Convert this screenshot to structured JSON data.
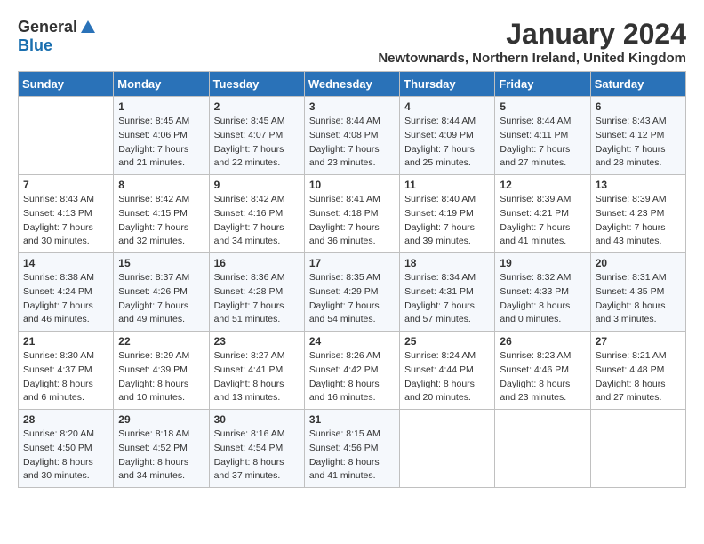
{
  "logo": {
    "general": "General",
    "blue": "Blue"
  },
  "title": {
    "month_year": "January 2024",
    "location": "Newtownards, Northern Ireland, United Kingdom"
  },
  "days_of_week": [
    "Sunday",
    "Monday",
    "Tuesday",
    "Wednesday",
    "Thursday",
    "Friday",
    "Saturday"
  ],
  "weeks": [
    [
      {
        "day": "",
        "sunrise": "",
        "sunset": "",
        "daylight": ""
      },
      {
        "day": "1",
        "sunrise": "Sunrise: 8:45 AM",
        "sunset": "Sunset: 4:06 PM",
        "daylight": "Daylight: 7 hours and 21 minutes."
      },
      {
        "day": "2",
        "sunrise": "Sunrise: 8:45 AM",
        "sunset": "Sunset: 4:07 PM",
        "daylight": "Daylight: 7 hours and 22 minutes."
      },
      {
        "day": "3",
        "sunrise": "Sunrise: 8:44 AM",
        "sunset": "Sunset: 4:08 PM",
        "daylight": "Daylight: 7 hours and 23 minutes."
      },
      {
        "day": "4",
        "sunrise": "Sunrise: 8:44 AM",
        "sunset": "Sunset: 4:09 PM",
        "daylight": "Daylight: 7 hours and 25 minutes."
      },
      {
        "day": "5",
        "sunrise": "Sunrise: 8:44 AM",
        "sunset": "Sunset: 4:11 PM",
        "daylight": "Daylight: 7 hours and 27 minutes."
      },
      {
        "day": "6",
        "sunrise": "Sunrise: 8:43 AM",
        "sunset": "Sunset: 4:12 PM",
        "daylight": "Daylight: 7 hours and 28 minutes."
      }
    ],
    [
      {
        "day": "7",
        "sunrise": "Sunrise: 8:43 AM",
        "sunset": "Sunset: 4:13 PM",
        "daylight": "Daylight: 7 hours and 30 minutes."
      },
      {
        "day": "8",
        "sunrise": "Sunrise: 8:42 AM",
        "sunset": "Sunset: 4:15 PM",
        "daylight": "Daylight: 7 hours and 32 minutes."
      },
      {
        "day": "9",
        "sunrise": "Sunrise: 8:42 AM",
        "sunset": "Sunset: 4:16 PM",
        "daylight": "Daylight: 7 hours and 34 minutes."
      },
      {
        "day": "10",
        "sunrise": "Sunrise: 8:41 AM",
        "sunset": "Sunset: 4:18 PM",
        "daylight": "Daylight: 7 hours and 36 minutes."
      },
      {
        "day": "11",
        "sunrise": "Sunrise: 8:40 AM",
        "sunset": "Sunset: 4:19 PM",
        "daylight": "Daylight: 7 hours and 39 minutes."
      },
      {
        "day": "12",
        "sunrise": "Sunrise: 8:39 AM",
        "sunset": "Sunset: 4:21 PM",
        "daylight": "Daylight: 7 hours and 41 minutes."
      },
      {
        "day": "13",
        "sunrise": "Sunrise: 8:39 AM",
        "sunset": "Sunset: 4:23 PM",
        "daylight": "Daylight: 7 hours and 43 minutes."
      }
    ],
    [
      {
        "day": "14",
        "sunrise": "Sunrise: 8:38 AM",
        "sunset": "Sunset: 4:24 PM",
        "daylight": "Daylight: 7 hours and 46 minutes."
      },
      {
        "day": "15",
        "sunrise": "Sunrise: 8:37 AM",
        "sunset": "Sunset: 4:26 PM",
        "daylight": "Daylight: 7 hours and 49 minutes."
      },
      {
        "day": "16",
        "sunrise": "Sunrise: 8:36 AM",
        "sunset": "Sunset: 4:28 PM",
        "daylight": "Daylight: 7 hours and 51 minutes."
      },
      {
        "day": "17",
        "sunrise": "Sunrise: 8:35 AM",
        "sunset": "Sunset: 4:29 PM",
        "daylight": "Daylight: 7 hours and 54 minutes."
      },
      {
        "day": "18",
        "sunrise": "Sunrise: 8:34 AM",
        "sunset": "Sunset: 4:31 PM",
        "daylight": "Daylight: 7 hours and 57 minutes."
      },
      {
        "day": "19",
        "sunrise": "Sunrise: 8:32 AM",
        "sunset": "Sunset: 4:33 PM",
        "daylight": "Daylight: 8 hours and 0 minutes."
      },
      {
        "day": "20",
        "sunrise": "Sunrise: 8:31 AM",
        "sunset": "Sunset: 4:35 PM",
        "daylight": "Daylight: 8 hours and 3 minutes."
      }
    ],
    [
      {
        "day": "21",
        "sunrise": "Sunrise: 8:30 AM",
        "sunset": "Sunset: 4:37 PM",
        "daylight": "Daylight: 8 hours and 6 minutes."
      },
      {
        "day": "22",
        "sunrise": "Sunrise: 8:29 AM",
        "sunset": "Sunset: 4:39 PM",
        "daylight": "Daylight: 8 hours and 10 minutes."
      },
      {
        "day": "23",
        "sunrise": "Sunrise: 8:27 AM",
        "sunset": "Sunset: 4:41 PM",
        "daylight": "Daylight: 8 hours and 13 minutes."
      },
      {
        "day": "24",
        "sunrise": "Sunrise: 8:26 AM",
        "sunset": "Sunset: 4:42 PM",
        "daylight": "Daylight: 8 hours and 16 minutes."
      },
      {
        "day": "25",
        "sunrise": "Sunrise: 8:24 AM",
        "sunset": "Sunset: 4:44 PM",
        "daylight": "Daylight: 8 hours and 20 minutes."
      },
      {
        "day": "26",
        "sunrise": "Sunrise: 8:23 AM",
        "sunset": "Sunset: 4:46 PM",
        "daylight": "Daylight: 8 hours and 23 minutes."
      },
      {
        "day": "27",
        "sunrise": "Sunrise: 8:21 AM",
        "sunset": "Sunset: 4:48 PM",
        "daylight": "Daylight: 8 hours and 27 minutes."
      }
    ],
    [
      {
        "day": "28",
        "sunrise": "Sunrise: 8:20 AM",
        "sunset": "Sunset: 4:50 PM",
        "daylight": "Daylight: 8 hours and 30 minutes."
      },
      {
        "day": "29",
        "sunrise": "Sunrise: 8:18 AM",
        "sunset": "Sunset: 4:52 PM",
        "daylight": "Daylight: 8 hours and 34 minutes."
      },
      {
        "day": "30",
        "sunrise": "Sunrise: 8:16 AM",
        "sunset": "Sunset: 4:54 PM",
        "daylight": "Daylight: 8 hours and 37 minutes."
      },
      {
        "day": "31",
        "sunrise": "Sunrise: 8:15 AM",
        "sunset": "Sunset: 4:56 PM",
        "daylight": "Daylight: 8 hours and 41 minutes."
      },
      {
        "day": "",
        "sunrise": "",
        "sunset": "",
        "daylight": ""
      },
      {
        "day": "",
        "sunrise": "",
        "sunset": "",
        "daylight": ""
      },
      {
        "day": "",
        "sunrise": "",
        "sunset": "",
        "daylight": ""
      }
    ]
  ]
}
